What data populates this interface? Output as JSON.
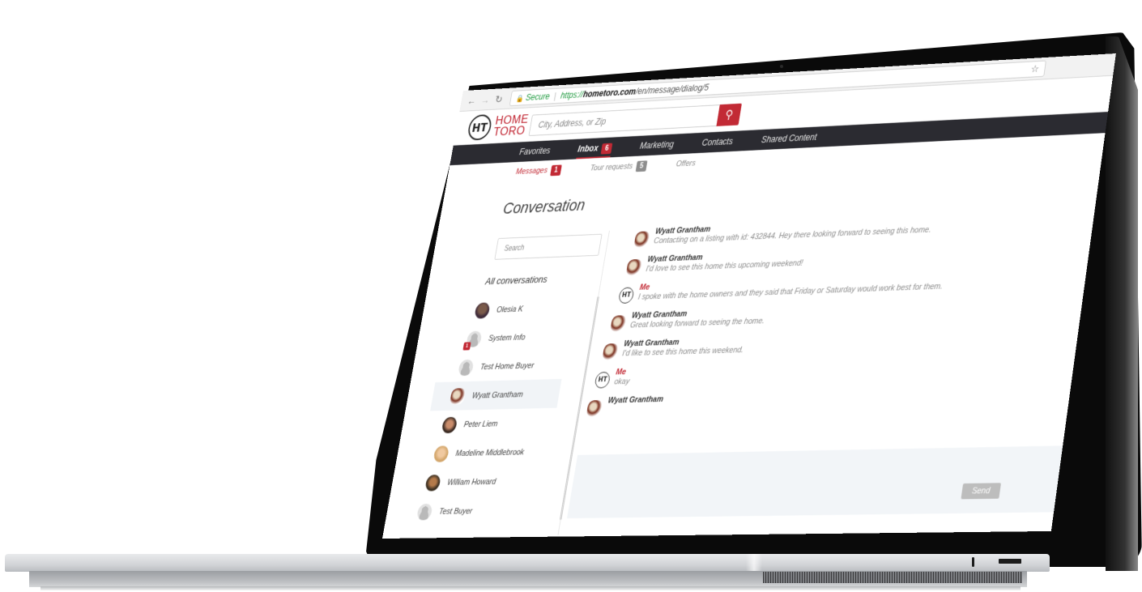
{
  "browser": {
    "secure_label": "Secure",
    "url_protocol": "https://",
    "url_host": "hometoro.com",
    "url_path": "/en/message/dialog/5",
    "back_icon": "arrow-left-icon",
    "forward_icon": "arrow-right-icon",
    "reload_icon": "reload-icon",
    "bookmark_icon": "star-icon"
  },
  "header": {
    "logo_line1": "HOME",
    "logo_line2": "TORO",
    "logo_mark": "HT",
    "search_placeholder": "City, Address, or Zip",
    "search_icon": "search-icon"
  },
  "main_nav": [
    {
      "label": "Favorites",
      "active": false
    },
    {
      "label": "Inbox",
      "active": true,
      "badge": "6"
    },
    {
      "label": "Marketing",
      "active": false
    },
    {
      "label": "Contacts",
      "active": false
    },
    {
      "label": "Shared Content",
      "active": false
    }
  ],
  "sub_nav": [
    {
      "label": "Messages",
      "active": true,
      "badge": "1"
    },
    {
      "label": "Tour requests",
      "active": false,
      "badge": "5"
    },
    {
      "label": "Offers",
      "active": false
    }
  ],
  "sidebar": {
    "title": "Conversation",
    "search_placeholder": "Search",
    "section_label": "All conversations",
    "conversations": [
      {
        "name": "Olesia K",
        "avatar": "photo1"
      },
      {
        "name": "System Info",
        "avatar": "default",
        "badge": "1"
      },
      {
        "name": "Test Home Buyer",
        "avatar": "default"
      },
      {
        "name": "Wyatt Grantham",
        "avatar": "dog",
        "selected": true
      },
      {
        "name": "Peter Liem",
        "avatar": "photo2"
      },
      {
        "name": "Madeline Middlebrook",
        "avatar": "photo3"
      },
      {
        "name": "William Howard",
        "avatar": "photo4"
      },
      {
        "name": "Test Buyer",
        "avatar": "default"
      }
    ]
  },
  "messages": [
    {
      "sender": "Wyatt Grantham",
      "is_me": false,
      "text": "Contacting on a listing with id: 432844. Hey there looking forward to seeing this home."
    },
    {
      "sender": "Wyatt Grantham",
      "is_me": false,
      "text": "I'd love to see this home this upcoming weekend!"
    },
    {
      "sender": "Me",
      "is_me": true,
      "text": "I spoke with the home owners and they said that Friday or Saturday would work best for them."
    },
    {
      "sender": "Wyatt Grantham",
      "is_me": false,
      "text": "Great looking forward to seeing the home."
    },
    {
      "sender": "Wyatt Grantham",
      "is_me": false,
      "text": "I'd like to see this home this weekend."
    },
    {
      "sender": "Me",
      "is_me": true,
      "text": "okay"
    },
    {
      "sender": "Wyatt Grantham",
      "is_me": false,
      "text": ""
    }
  ],
  "composer": {
    "value": "",
    "send_label": "Send"
  },
  "colors": {
    "brand_red": "#c22a35",
    "nav_dark": "#2b2b31",
    "secure_green": "#1e9a3e",
    "composer_bg": "#f2f5f8"
  }
}
